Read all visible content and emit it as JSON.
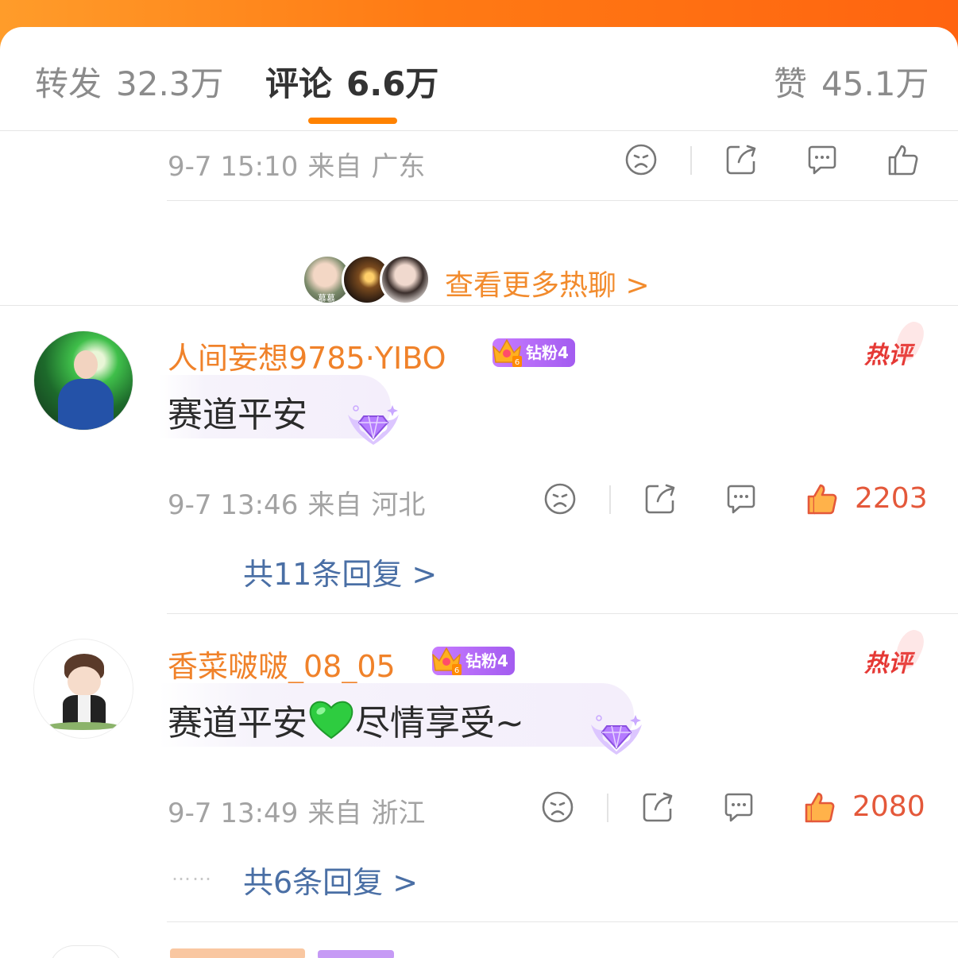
{
  "tabs": [
    {
      "label": "转发",
      "count": "32.3万"
    },
    {
      "label": "评论",
      "count": "6.6万"
    },
    {
      "label": "赞",
      "count": "45.1万"
    }
  ],
  "prev_comment": {
    "time": "9-7 15:10",
    "source_prefix": "来自",
    "location": "广东"
  },
  "more_hot": {
    "label": "查看更多热聊 >",
    "avatar_tag": "慕慕"
  },
  "comments": [
    {
      "username": "人间妄想9785·YIBO",
      "badge": "钻粉4",
      "hot_tag": "热评",
      "text": "赛道平安",
      "time": "9-7 13:46",
      "source_prefix": "来自",
      "location": "河北",
      "likes": "2203",
      "replies": "共11条回复 >"
    },
    {
      "username": "香菜啵啵_08_05",
      "badge": "钻粉4",
      "hot_tag": "热评",
      "text_before_emoji": "赛道平安",
      "emoji": "green-heart",
      "text_after_emoji": "尽情享受~",
      "time": "9-7 13:49",
      "source_prefix": "来自",
      "location": "浙江",
      "likes": "2080",
      "replies": "共6条回复 >",
      "dots": "……"
    }
  ],
  "colors": {
    "accent_orange": "#ff8200",
    "username_orange": "#f0822a",
    "like_red": "#e4583a",
    "hot_red": "#e53935",
    "reply_blue": "#4a6fa5",
    "badge_purple": "#b36bf5"
  }
}
